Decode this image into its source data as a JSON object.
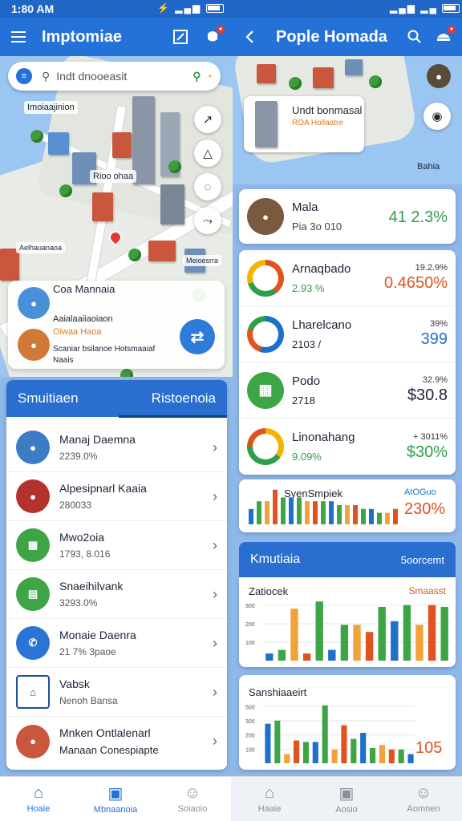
{
  "status": {
    "time": "1:80 AM"
  },
  "left_appbar": {
    "title": "Imptomiae"
  },
  "right_appbar": {
    "title": "Pople Homada"
  },
  "search": {
    "placeholder": "Indt dnooeasit"
  },
  "map": {
    "label_top": "Imoiaajinion",
    "label_center": "Rioo ohaa",
    "label_low": "Aelhauanaoa",
    "label_low2": "Meioesrra"
  },
  "map_card": {
    "title": "Coa Mannaia",
    "line1": "Aaialaaiiaoiaon",
    "line2": "Oiwaa Haoa",
    "line3": "Scaniar bsilanoe Hotsmaaiaf",
    "line4": "Naais"
  },
  "list": {
    "tab_left": "Smuitiaen",
    "tab_right": "Ristoenoia",
    "items": [
      {
        "name": "Manaj Daemna",
        "sub": "2239.0%",
        "icon": "person-avatar"
      },
      {
        "name": "Alpesipnarl Kaaia",
        "sub": "280033",
        "icon": "person-avatar"
      },
      {
        "name": "Mwo2oia",
        "sub": "1793, 8.016",
        "icon": "map-icon"
      },
      {
        "name": "Snaeihilvank",
        "sub": "3293.0%",
        "icon": "document-icon"
      },
      {
        "name": "Monaie Daenra",
        "sub": "21 7% 3paoe",
        "icon": "phone-icon"
      },
      {
        "name": "Vabsk",
        "sub": "Nenoh Bansa",
        "icon": "bank-icon"
      },
      {
        "name": "Mnken Ontlalenarl",
        "sub": "Manaan Conespiapte",
        "icon": "person-avatar"
      }
    ]
  },
  "right_map": {
    "label_title": "Undt bonmasal",
    "label_sub": "ROA Hollaatre",
    "corner": "Bahia"
  },
  "stats": [
    {
      "name": "Mala",
      "sub": "Pia 3o 010",
      "small": "",
      "value": "41 2.3%",
      "color": "#2e9e4a",
      "ring": "avatar"
    },
    {
      "name": "Arnaqbado",
      "sub": "2.93 %",
      "small": "19.2.9%",
      "value": "0.4650%",
      "color": "#e0531f",
      "ring": "ring-orange"
    },
    {
      "name": "Lharelcano",
      "sub": "2103 /",
      "small": "39%",
      "value": "399",
      "color": "#1f6fcf",
      "ring": "ring-blue"
    },
    {
      "name": "Podo",
      "sub": "2718",
      "small": "32.9%",
      "value": "$30.8",
      "color": "#1c2333",
      "ring": "ring-green"
    },
    {
      "name": "Linonahang",
      "sub": "9.09%",
      "small": "+ 3011%",
      "value": "$30%",
      "color": "#2e9e4a",
      "ring": "ring-yellow"
    }
  ],
  "mini_chart": {
    "title": "SyenSmpiek",
    "label": "AtOGuo",
    "value": "230%",
    "bars": [
      4,
      6,
      6,
      9,
      7,
      7,
      7,
      6,
      6,
      6,
      6,
      5,
      5,
      5,
      4,
      4,
      3,
      3,
      4
    ]
  },
  "section": {
    "title": "Kmutiaia",
    "action": "5oorcemt"
  },
  "chart1": {
    "title": "Zatiocek",
    "label": "Smaasst",
    "yticks": [
      "100",
      "200",
      "300"
    ],
    "values": [
      40,
      60,
      290,
      40,
      330,
      60,
      200,
      200,
      160,
      300,
      220,
      310,
      200,
      310,
      300
    ]
  },
  "chart2": {
    "title": "Sanshiaaeirt",
    "label": "105",
    "yticks": [
      "100",
      "200",
      "300",
      "500"
    ],
    "values": [
      260,
      280,
      60,
      150,
      140,
      140,
      380,
      90,
      250,
      160,
      200,
      100,
      120,
      90,
      90,
      60
    ]
  },
  "bottom_nav": [
    {
      "label": "Hoaie",
      "icon": "home-icon",
      "active": true
    },
    {
      "label": "Mbnaanoia",
      "icon": "wallet-icon",
      "active": true
    },
    {
      "label": "Soiaoio",
      "icon": "profile-icon",
      "active": false
    },
    {
      "label": "Haaie",
      "icon": "home-icon",
      "active": false
    },
    {
      "label": "Aosio",
      "icon": "wallet-icon",
      "active": false
    },
    {
      "label": "Aomnen",
      "icon": "profile-icon",
      "active": false
    }
  ]
}
